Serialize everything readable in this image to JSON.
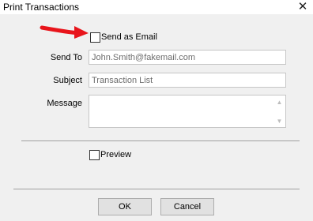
{
  "window": {
    "title": "Print Transactions",
    "close_glyph": "✕"
  },
  "send_as_email": {
    "label": "Send as Email",
    "checked": false
  },
  "fields": {
    "send_to": {
      "label": "Send To",
      "value": "John.Smith@fakemail.com"
    },
    "subject": {
      "label": "Subject",
      "value": "Transaction List"
    },
    "message": {
      "label": "Message",
      "value": ""
    }
  },
  "preview": {
    "label": "Preview",
    "checked": false
  },
  "buttons": {
    "ok": "OK",
    "cancel": "Cancel"
  },
  "colors": {
    "arrow": "#e8141b",
    "accent": "#0078d7"
  }
}
